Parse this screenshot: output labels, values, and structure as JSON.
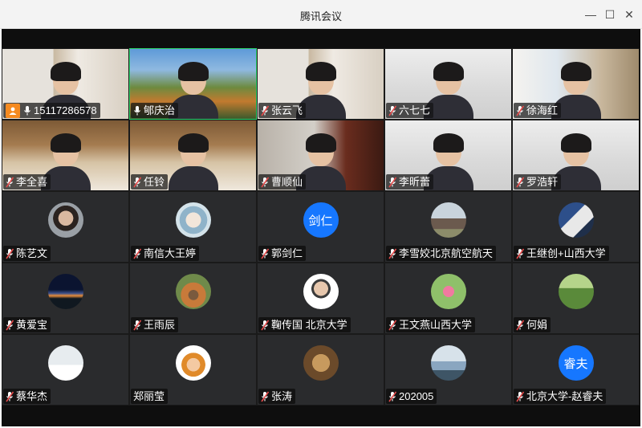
{
  "window": {
    "title": "腾讯会议",
    "controls": {
      "minimize": "—",
      "maximize": "☐",
      "close": "✕"
    }
  },
  "participants": [
    {
      "name": "15117286578",
      "type": "video",
      "bg": "bg-shelf-light",
      "host": true,
      "mic": "on",
      "speaking": false
    },
    {
      "name": "郇庆治",
      "type": "video",
      "bg": "bg-park",
      "host": false,
      "mic": "on",
      "speaking": true
    },
    {
      "name": "张云飞",
      "type": "video",
      "bg": "bg-shelf-light",
      "host": false,
      "mic": "muted",
      "speaking": false
    },
    {
      "name": "六七七",
      "type": "video",
      "bg": "bg-room-white",
      "host": false,
      "mic": "muted",
      "speaking": false
    },
    {
      "name": "徐海红",
      "type": "video",
      "bg": "bg-window",
      "host": false,
      "mic": "muted",
      "speaking": false
    },
    {
      "name": "李全喜",
      "type": "video",
      "bg": "bg-bookroom",
      "host": false,
      "mic": "muted",
      "speaking": false
    },
    {
      "name": "任铃",
      "type": "video",
      "bg": "bg-bookroom",
      "host": false,
      "mic": "muted",
      "speaking": false
    },
    {
      "name": "曹顺仙",
      "type": "video",
      "bg": "bg-redshelf",
      "host": false,
      "mic": "muted",
      "speaking": false
    },
    {
      "name": "李昕蕾",
      "type": "video",
      "bg": "bg-room-white",
      "host": false,
      "mic": "muted",
      "speaking": false
    },
    {
      "name": "罗浩轩",
      "type": "video",
      "bg": "bg-room-white",
      "host": false,
      "mic": "muted",
      "speaking": false
    },
    {
      "name": "陈艺文",
      "type": "avatar",
      "avatar_style": "photo-portrait",
      "mic": "muted"
    },
    {
      "name": "南信大王婷",
      "type": "avatar",
      "avatar_style": "photo-anime",
      "mic": "muted"
    },
    {
      "name": "郭剑仁",
      "type": "avatar",
      "avatar_style": "initials",
      "initials": "剑仁",
      "mic": "muted"
    },
    {
      "name": "李雪姣北京航空航天",
      "type": "avatar",
      "avatar_style": "photo-house",
      "mic": "muted"
    },
    {
      "name": "王继创+山西大学",
      "type": "avatar",
      "avatar_style": "photo-office",
      "mic": "muted"
    },
    {
      "name": "黄爱宝",
      "type": "avatar",
      "avatar_style": "photo-night",
      "mic": "muted"
    },
    {
      "name": "王雨辰",
      "type": "avatar",
      "avatar_style": "photo-autumn",
      "mic": "muted"
    },
    {
      "name": "鞠传国 北京大学",
      "type": "avatar",
      "avatar_style": "photo-man",
      "mic": "muted"
    },
    {
      "name": "王文燕山西大学",
      "type": "avatar",
      "avatar_style": "photo-flower",
      "mic": "muted"
    },
    {
      "name": "何娟",
      "type": "avatar",
      "avatar_style": "photo-field",
      "mic": "muted"
    },
    {
      "name": "蔡华杰",
      "type": "avatar",
      "avatar_style": "photo-snow",
      "mic": "muted"
    },
    {
      "name": "郑丽莹",
      "type": "avatar",
      "avatar_style": "photo-cartoon",
      "mic": "none"
    },
    {
      "name": "张涛",
      "type": "avatar",
      "avatar_style": "photo-dog",
      "mic": "muted"
    },
    {
      "name": "202005",
      "type": "avatar",
      "avatar_style": "photo-lake",
      "mic": "muted"
    },
    {
      "name": "北京大学-赵睿夫",
      "type": "avatar",
      "avatar_style": "initials",
      "initials": "睿夫",
      "mic": "muted"
    }
  ],
  "colors": {
    "accent_avatar": "#1677ff",
    "speaking_border": "#2bd46a",
    "host_badge": "#f58a20",
    "muted_mic": "#e54b4b"
  }
}
